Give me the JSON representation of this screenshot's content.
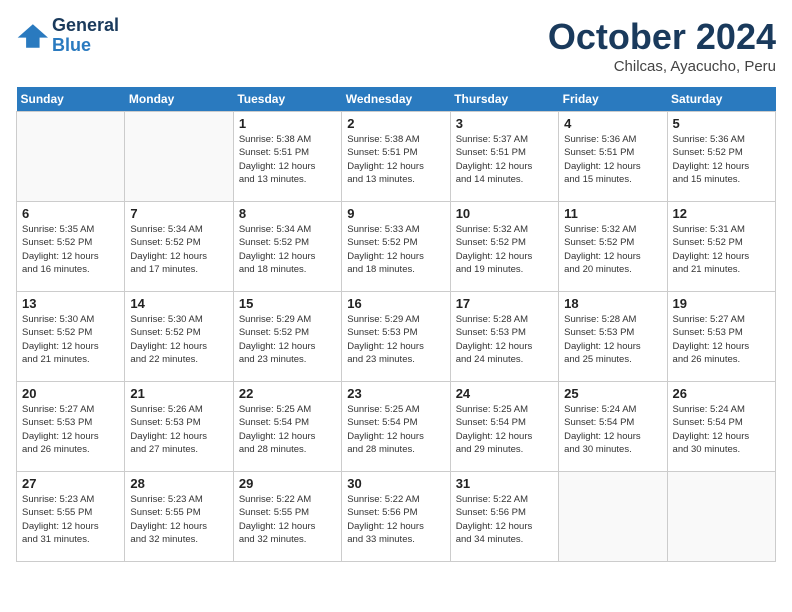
{
  "logo": {
    "line1": "General",
    "line2": "Blue"
  },
  "title": "October 2024",
  "subtitle": "Chilcas, Ayacucho, Peru",
  "days_of_week": [
    "Sunday",
    "Monday",
    "Tuesday",
    "Wednesday",
    "Thursday",
    "Friday",
    "Saturday"
  ],
  "weeks": [
    [
      {
        "day": "",
        "info": ""
      },
      {
        "day": "",
        "info": ""
      },
      {
        "day": "1",
        "info": "Sunrise: 5:38 AM\nSunset: 5:51 PM\nDaylight: 12 hours\nand 13 minutes."
      },
      {
        "day": "2",
        "info": "Sunrise: 5:38 AM\nSunset: 5:51 PM\nDaylight: 12 hours\nand 13 minutes."
      },
      {
        "day": "3",
        "info": "Sunrise: 5:37 AM\nSunset: 5:51 PM\nDaylight: 12 hours\nand 14 minutes."
      },
      {
        "day": "4",
        "info": "Sunrise: 5:36 AM\nSunset: 5:51 PM\nDaylight: 12 hours\nand 15 minutes."
      },
      {
        "day": "5",
        "info": "Sunrise: 5:36 AM\nSunset: 5:52 PM\nDaylight: 12 hours\nand 15 minutes."
      }
    ],
    [
      {
        "day": "6",
        "info": "Sunrise: 5:35 AM\nSunset: 5:52 PM\nDaylight: 12 hours\nand 16 minutes."
      },
      {
        "day": "7",
        "info": "Sunrise: 5:34 AM\nSunset: 5:52 PM\nDaylight: 12 hours\nand 17 minutes."
      },
      {
        "day": "8",
        "info": "Sunrise: 5:34 AM\nSunset: 5:52 PM\nDaylight: 12 hours\nand 18 minutes."
      },
      {
        "day": "9",
        "info": "Sunrise: 5:33 AM\nSunset: 5:52 PM\nDaylight: 12 hours\nand 18 minutes."
      },
      {
        "day": "10",
        "info": "Sunrise: 5:32 AM\nSunset: 5:52 PM\nDaylight: 12 hours\nand 19 minutes."
      },
      {
        "day": "11",
        "info": "Sunrise: 5:32 AM\nSunset: 5:52 PM\nDaylight: 12 hours\nand 20 minutes."
      },
      {
        "day": "12",
        "info": "Sunrise: 5:31 AM\nSunset: 5:52 PM\nDaylight: 12 hours\nand 21 minutes."
      }
    ],
    [
      {
        "day": "13",
        "info": "Sunrise: 5:30 AM\nSunset: 5:52 PM\nDaylight: 12 hours\nand 21 minutes."
      },
      {
        "day": "14",
        "info": "Sunrise: 5:30 AM\nSunset: 5:52 PM\nDaylight: 12 hours\nand 22 minutes."
      },
      {
        "day": "15",
        "info": "Sunrise: 5:29 AM\nSunset: 5:52 PM\nDaylight: 12 hours\nand 23 minutes."
      },
      {
        "day": "16",
        "info": "Sunrise: 5:29 AM\nSunset: 5:53 PM\nDaylight: 12 hours\nand 23 minutes."
      },
      {
        "day": "17",
        "info": "Sunrise: 5:28 AM\nSunset: 5:53 PM\nDaylight: 12 hours\nand 24 minutes."
      },
      {
        "day": "18",
        "info": "Sunrise: 5:28 AM\nSunset: 5:53 PM\nDaylight: 12 hours\nand 25 minutes."
      },
      {
        "day": "19",
        "info": "Sunrise: 5:27 AM\nSunset: 5:53 PM\nDaylight: 12 hours\nand 26 minutes."
      }
    ],
    [
      {
        "day": "20",
        "info": "Sunrise: 5:27 AM\nSunset: 5:53 PM\nDaylight: 12 hours\nand 26 minutes."
      },
      {
        "day": "21",
        "info": "Sunrise: 5:26 AM\nSunset: 5:53 PM\nDaylight: 12 hours\nand 27 minutes."
      },
      {
        "day": "22",
        "info": "Sunrise: 5:25 AM\nSunset: 5:54 PM\nDaylight: 12 hours\nand 28 minutes."
      },
      {
        "day": "23",
        "info": "Sunrise: 5:25 AM\nSunset: 5:54 PM\nDaylight: 12 hours\nand 28 minutes."
      },
      {
        "day": "24",
        "info": "Sunrise: 5:25 AM\nSunset: 5:54 PM\nDaylight: 12 hours\nand 29 minutes."
      },
      {
        "day": "25",
        "info": "Sunrise: 5:24 AM\nSunset: 5:54 PM\nDaylight: 12 hours\nand 30 minutes."
      },
      {
        "day": "26",
        "info": "Sunrise: 5:24 AM\nSunset: 5:54 PM\nDaylight: 12 hours\nand 30 minutes."
      }
    ],
    [
      {
        "day": "27",
        "info": "Sunrise: 5:23 AM\nSunset: 5:55 PM\nDaylight: 12 hours\nand 31 minutes."
      },
      {
        "day": "28",
        "info": "Sunrise: 5:23 AM\nSunset: 5:55 PM\nDaylight: 12 hours\nand 32 minutes."
      },
      {
        "day": "29",
        "info": "Sunrise: 5:22 AM\nSunset: 5:55 PM\nDaylight: 12 hours\nand 32 minutes."
      },
      {
        "day": "30",
        "info": "Sunrise: 5:22 AM\nSunset: 5:56 PM\nDaylight: 12 hours\nand 33 minutes."
      },
      {
        "day": "31",
        "info": "Sunrise: 5:22 AM\nSunset: 5:56 PM\nDaylight: 12 hours\nand 34 minutes."
      },
      {
        "day": "",
        "info": ""
      },
      {
        "day": "",
        "info": ""
      }
    ]
  ]
}
